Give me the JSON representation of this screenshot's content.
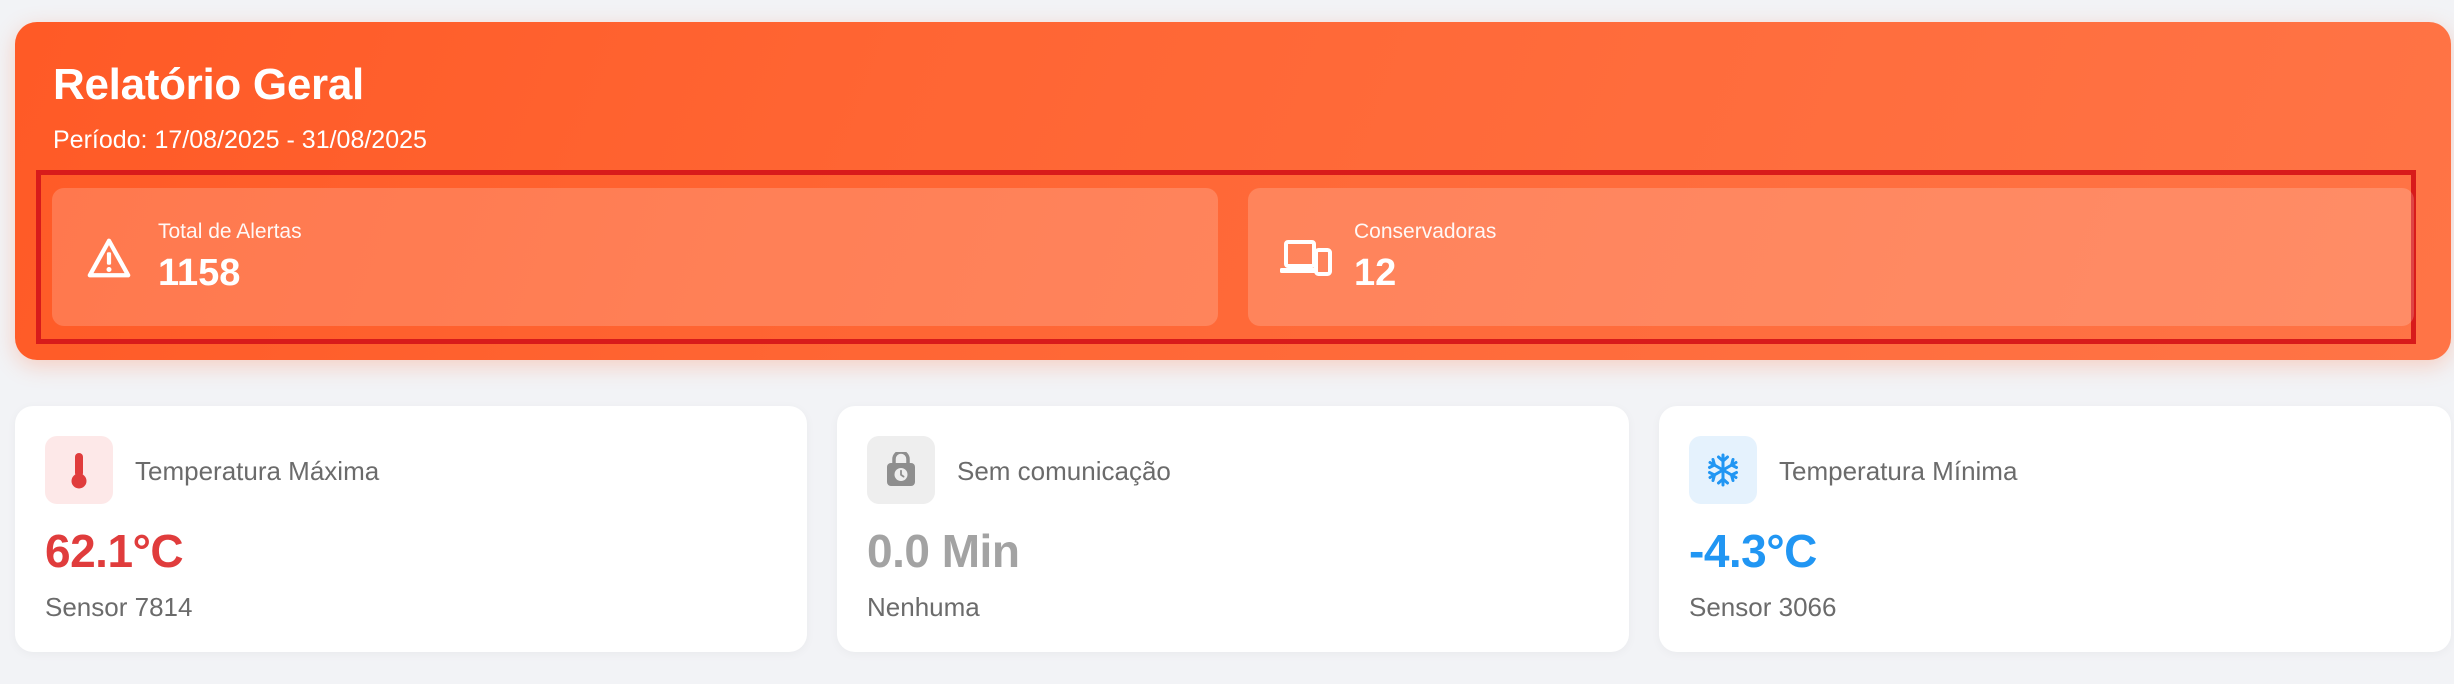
{
  "header": {
    "title": "Relatório Geral",
    "period": "Período: 17/08/2025 - 31/08/2025",
    "stats": [
      {
        "label": "Total de Alertas",
        "value": "1158",
        "icon": "warning-icon"
      },
      {
        "label": "Conservadoras",
        "value": "12",
        "icon": "devices-icon"
      }
    ]
  },
  "metrics": [
    {
      "label": "Temperatura Máxima",
      "value": "62.1°C",
      "sub": "Sensor 7814",
      "icon": "thermometer-icon",
      "color": "#e03c3c"
    },
    {
      "label": "Sem comunicação",
      "value": "0.0 Min",
      "sub": "Nenhuma",
      "icon": "padlock-clock-icon",
      "color": "#a3a3a3"
    },
    {
      "label": "Temperatura Mínima",
      "value": "-4.3°C",
      "sub": "Sensor 3066",
      "icon": "snowflake-icon",
      "color": "#2196f3"
    }
  ],
  "colors": {
    "header_gradient_start": "#ff5a26",
    "header_gradient_end": "#ff7446",
    "highlight_border": "#d81b1b",
    "page_background": "#f2f3f6"
  }
}
